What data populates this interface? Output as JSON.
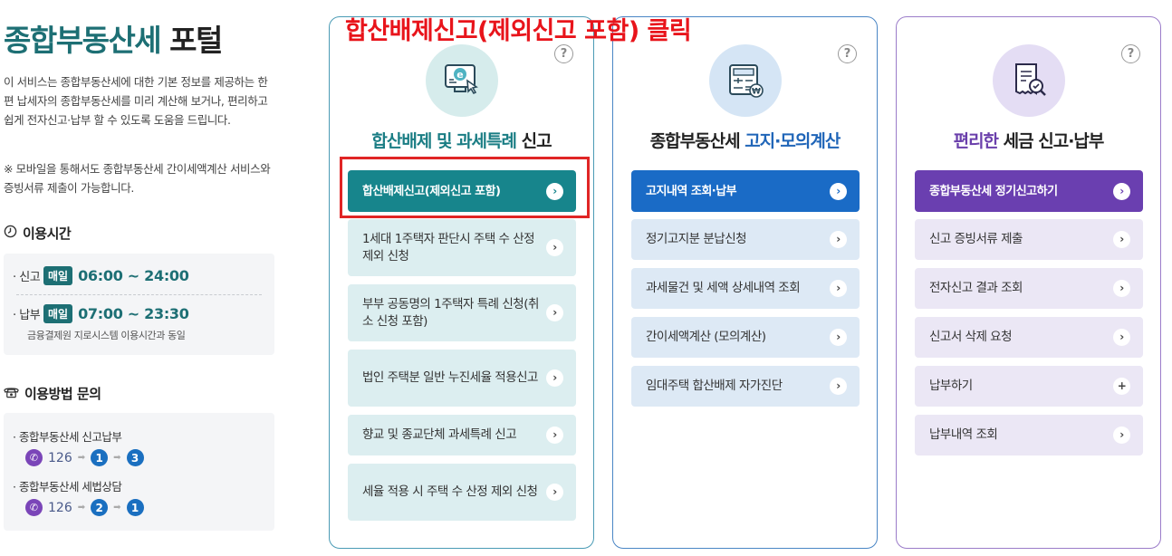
{
  "left": {
    "title_teal": "종합부동산세",
    "title_dark": "포털",
    "intro": "이 서비스는 종합부동산세에 대한 기본 정보를 제공하는 한편 납세자의 종합부동산세를 미리 계산해 보거나, 편리하고 쉽게 전자신고·납부 할 수 있도록 도움을 드립니다.",
    "mobile_note": "※ 모바일을 통해서도 종합부동산세 간이세액계산 서비스와 증빙서류 제출이 가능합니다.",
    "hours_heading": "이용시간",
    "hours": [
      {
        "label": "신고",
        "badge": "매일",
        "time": "06:00 ~ 24:00"
      },
      {
        "label": "납부",
        "badge": "매일",
        "time": "07:00 ~ 23:30"
      }
    ],
    "hours_note": "금융결제원 지로시스템 이용시간과 동일",
    "contact_heading": "이용방법 문의",
    "contacts": [
      {
        "title": "종합부동산세 신고납부",
        "phone": "126",
        "steps": [
          "1",
          "3"
        ]
      },
      {
        "title": "종합부동산세 세법상담",
        "phone": "126",
        "steps": [
          "2",
          "1"
        ]
      }
    ]
  },
  "annotation": "합산배제신고(제외신고 포함) 클릭",
  "cards": [
    {
      "icon": "computer-e-icon",
      "title_accent": "합산배제 및 과세특례",
      "title_rest": "신고",
      "primary": "합산배제신고(제외신고 포함)",
      "buttons": [
        "1세대 1주택자 판단시 주택 수 산정 제외 신청",
        "부부 공동명의 1주택자 특례 신청(취소 신청 포함)",
        "법인 주택분 일반 누진세율 적용신고",
        "향교 및 종교단체 과세특례 신고",
        "세율 적용 시 주택 수 산정 제외 신청"
      ]
    },
    {
      "icon": "calculator-icon",
      "title_rest": "종합부동산세",
      "title_accent": "고지·모의계산",
      "primary": "고지내역 조회·납부",
      "buttons": [
        "정기고지분 분납신청",
        "과세물건 및 세액 상세내역 조회",
        "간이세액계산 (모의계산)",
        "임대주택 합산배제 자가진단"
      ]
    },
    {
      "icon": "receipt-search-icon",
      "title_accent": "편리한",
      "title_rest": "세금 신고·납부",
      "primary": "종합부동산세 정기신고하기",
      "buttons": [
        "신고 증빙서류 제출",
        "전자신고 결과 조회",
        "신고서 삭제 요청",
        "납부하기",
        "납부내역 조회"
      ]
    }
  ],
  "help_label": "?"
}
